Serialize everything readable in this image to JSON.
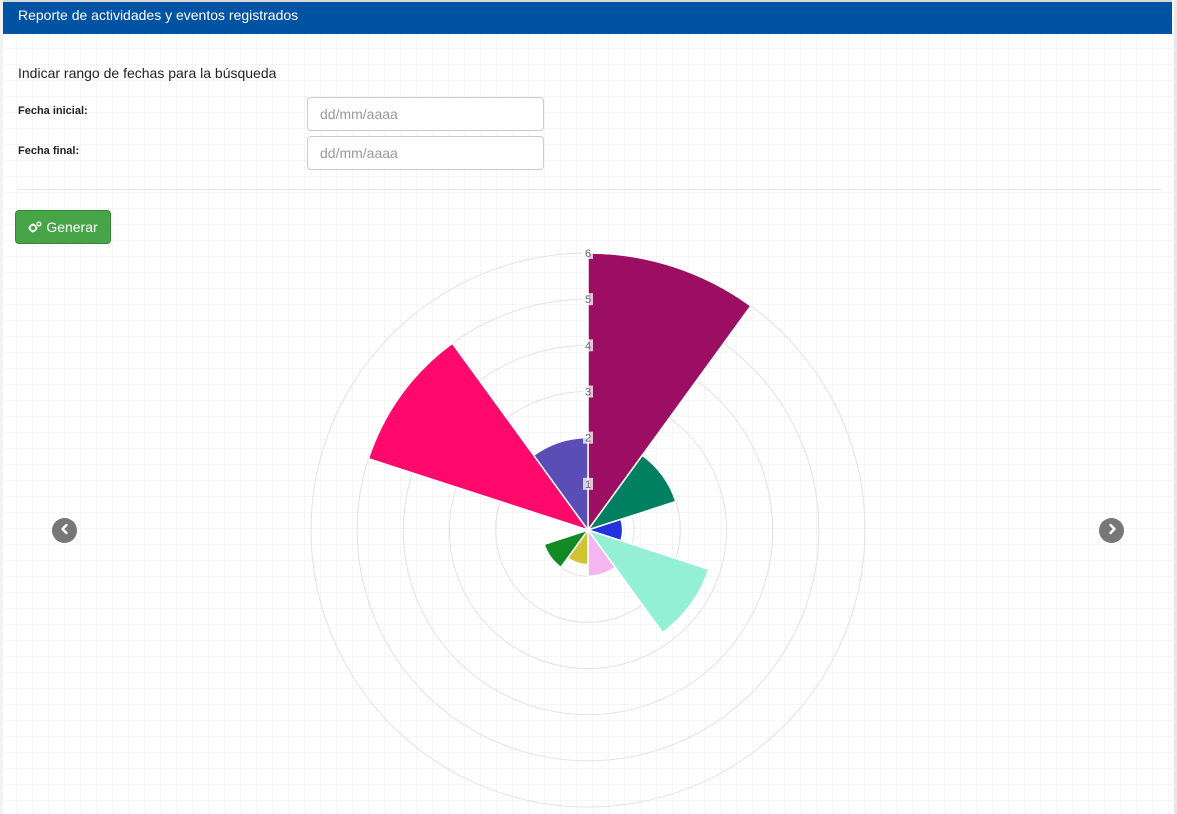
{
  "panel": {
    "title": "Reporte de actividades y eventos registrados"
  },
  "form": {
    "intro": "Indicar rango de fechas para la búsqueda",
    "start_label": "Fecha inicial:",
    "end_label": "Fecha final:",
    "start_value": "",
    "end_value": "",
    "start_placeholder": "dd/mm/aaaa",
    "end_placeholder": "dd/mm/aaaa"
  },
  "button": {
    "generate_label": "Generar",
    "icon": "gears-icon"
  },
  "nav": {
    "prev_icon": "chevron-left-icon",
    "next_icon": "chevron-right-icon"
  },
  "chart_data": {
    "type": "polarArea",
    "r_min": 0,
    "r_max": 6,
    "ticks": [
      "1",
      "2",
      "3",
      "4",
      "5",
      "6"
    ],
    "grid": true,
    "legend": "none",
    "values": [
      6,
      2,
      0.75,
      2.75,
      1,
      0.75,
      1,
      1,
      5,
      2
    ],
    "colors": [
      "#9b0e64",
      "#008060",
      "#2233dd",
      "#94f0d4",
      "#f5b6f0",
      "#cfc432",
      "#128a24",
      "#ffffff",
      "#ff0a6c",
      "#5a4db6"
    ]
  }
}
